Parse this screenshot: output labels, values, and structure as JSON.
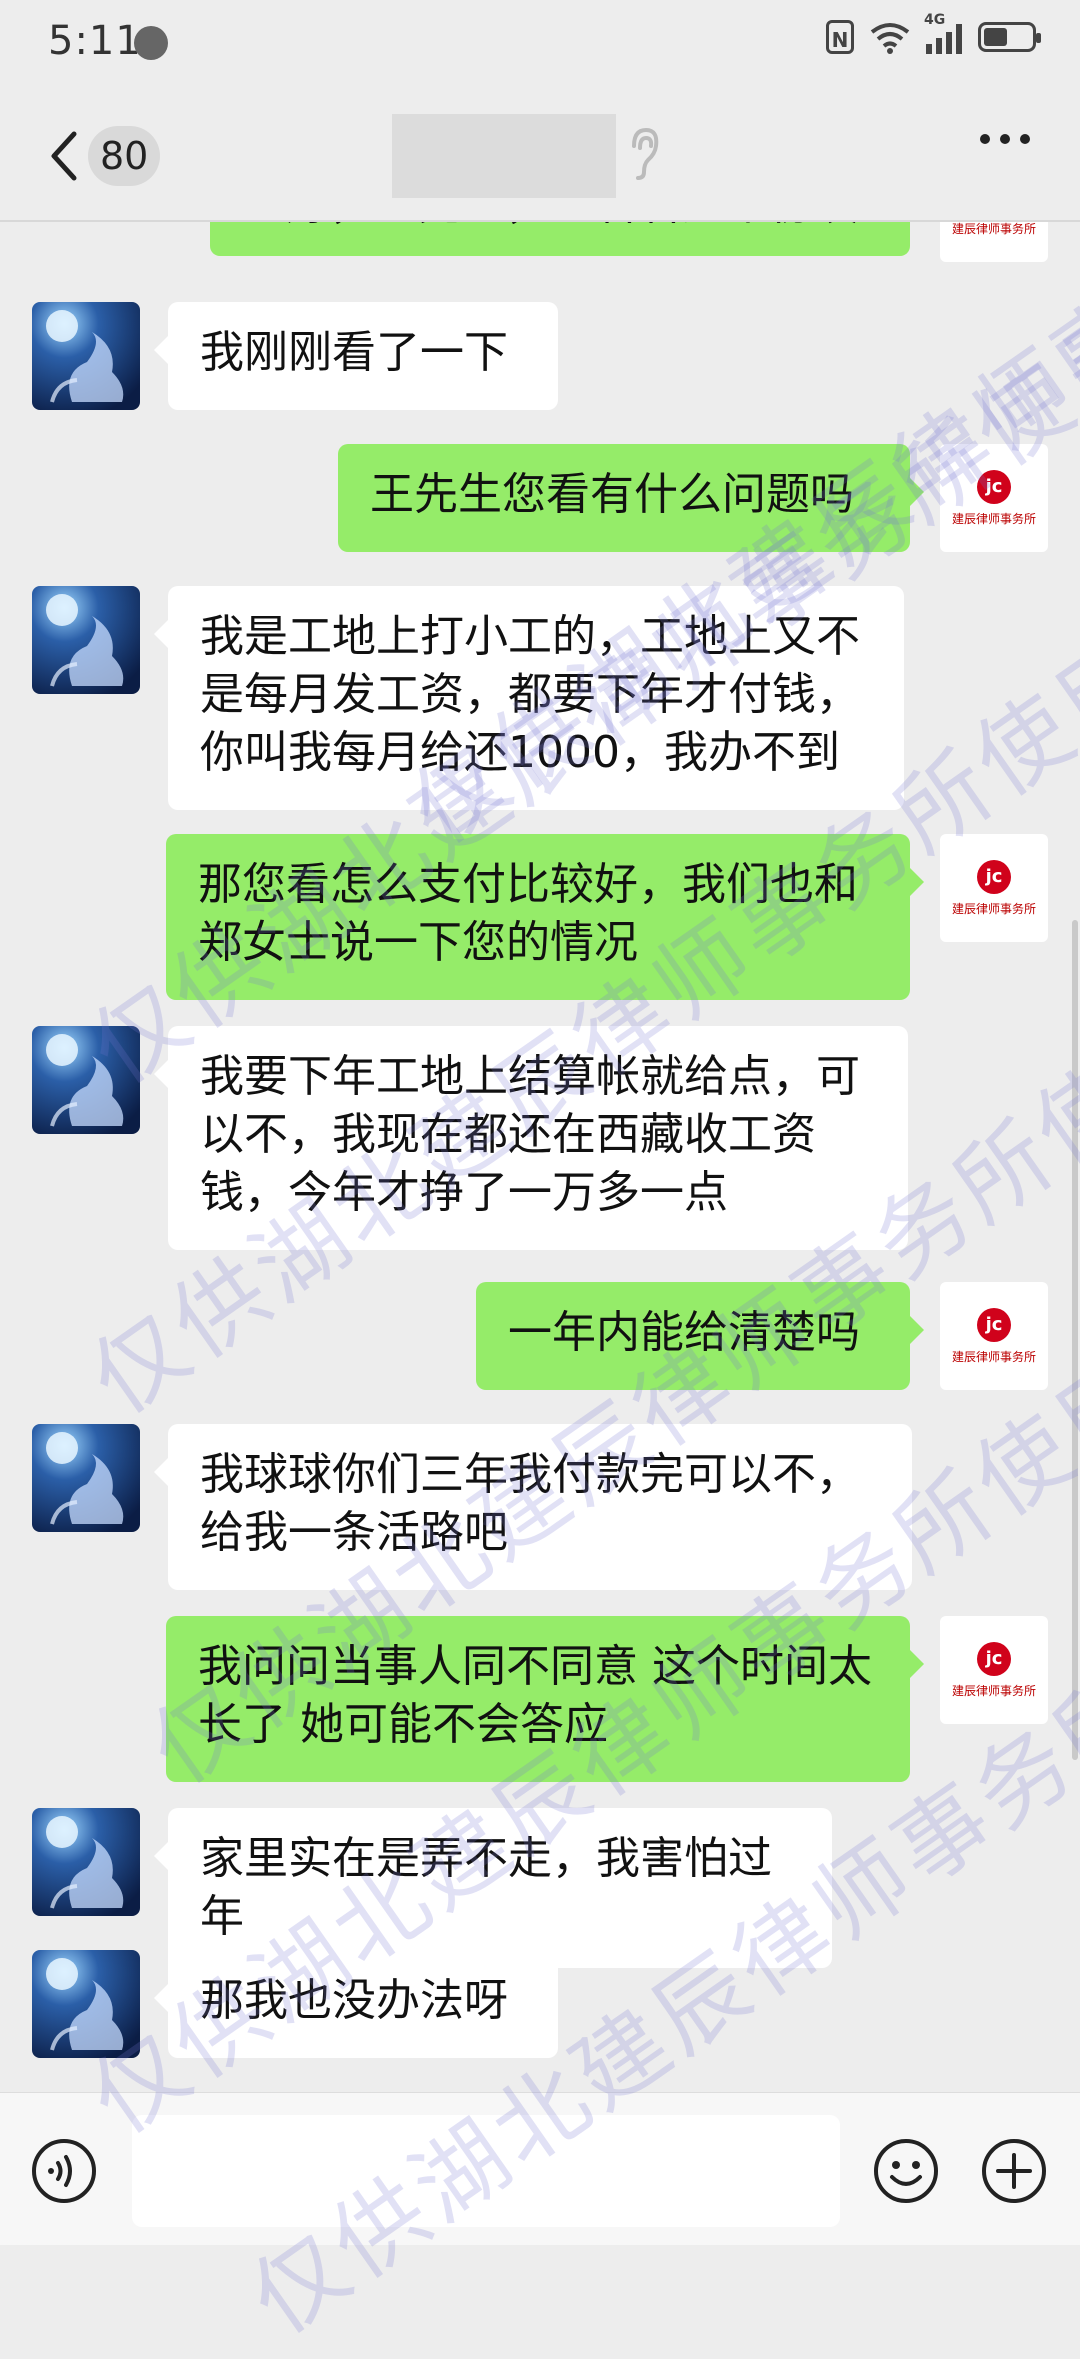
{
  "status_bar": {
    "time": "5:11",
    "network": "4G"
  },
  "header": {
    "unread_count": "80"
  },
  "messages": [
    {
      "side": "right",
      "text": "您好，王先生，您看看这个协议"
    },
    {
      "side": "left",
      "text": "我刚刚看了一下"
    },
    {
      "side": "right",
      "text": "王先生您看有什么问题吗"
    },
    {
      "side": "left",
      "text": "我是工地上打小工的，工地上又不是每月发工资，都要下年才付钱，你叫我每月给还1000，我办不到"
    },
    {
      "side": "right",
      "text": "那您看怎么支付比较好，我们也和郑女士说一下您的情况"
    },
    {
      "side": "left",
      "text": "我要下年工地上结算帐就给点，可以不，我现在都还在西藏收工资钱，今年才挣了一万多一点"
    },
    {
      "side": "right",
      "text": "一年内能给清楚吗"
    },
    {
      "side": "left",
      "text": "我球球你们三年我付款完可以不，给我一条活路吧"
    },
    {
      "side": "right",
      "text": "我问问当事人同不同意 这个时间太长了 她可能不会答应"
    },
    {
      "side": "left",
      "text": "家里实在是弄不走，我害怕过年"
    },
    {
      "side": "left",
      "text": "那我也没办法呀"
    }
  ],
  "firm_avatar": {
    "mark": "jc",
    "label": "建辰律师事务所"
  },
  "watermark_text": "仅供湖北建辰律师事务所使用",
  "input_bar": {
    "placeholder": ""
  },
  "colors": {
    "background": "#ededed",
    "sent_bubble": "#95ec69",
    "received_bubble": "#ffffff",
    "watermark": "#7878d2"
  }
}
